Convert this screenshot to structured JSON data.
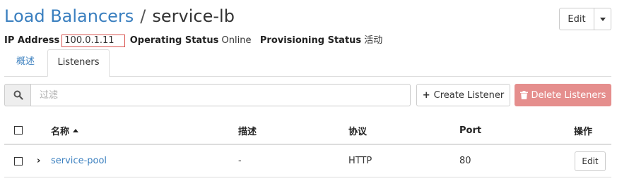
{
  "breadcrumb": {
    "parent": "Load Balancers",
    "separator": "/",
    "current": "service-lb"
  },
  "actions": {
    "edit_label": "Edit"
  },
  "info": {
    "ip_label": "IP Address",
    "ip_value": "100.0.1.11",
    "op_label": "Operating Status",
    "op_value": "Online",
    "prov_label": "Provisioning Status",
    "prov_value": "活动"
  },
  "tabs": [
    {
      "label": "概述"
    },
    {
      "label": "Listeners"
    }
  ],
  "toolbar": {
    "filter_placeholder": "过滤",
    "create_label": "Create Listener",
    "delete_label": "Delete Listeners"
  },
  "table": {
    "headers": {
      "name": "名称",
      "description": "描述",
      "protocol": "协议",
      "port": "Port",
      "actions": "操作"
    },
    "rows": [
      {
        "name": "service-pool",
        "description": "-",
        "protocol": "HTTP",
        "port": "80",
        "action": "Edit"
      }
    ]
  },
  "colors": {
    "link": "#3a7fbf",
    "danger_disabled": "#e58e8d",
    "ip_highlight": "#d9534f"
  }
}
